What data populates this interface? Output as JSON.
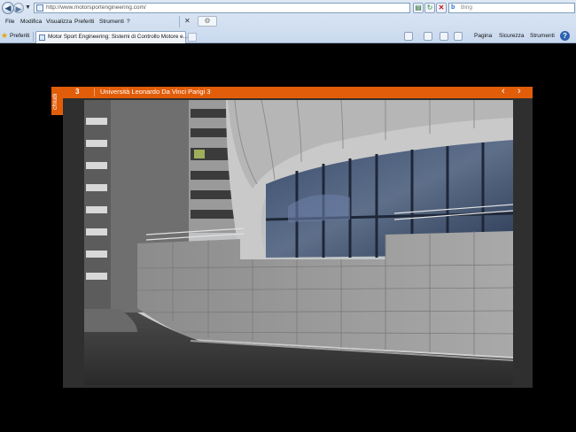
{
  "browser": {
    "address": "http://www.motorsportengineering.com/",
    "search_placeholder": "Bing",
    "bing_logo": "b",
    "menu": [
      "File",
      "Modifica",
      "Visualizza",
      "Preferiti",
      "Strumenti",
      "?"
    ],
    "favorites_label": "Preferiti",
    "tab_title": "Motor Sport Engineering: Sistemi di Controllo Motore e...",
    "commands": [
      "Pagina",
      "Sicurezza",
      "Strumenti"
    ],
    "icons": {
      "back": "back-arrow-icon",
      "forward": "forward-arrow-icon",
      "refresh": "refresh-icon",
      "stop": "stop-icon",
      "favorites": "star-icon",
      "help": "help-icon"
    }
  },
  "gallery": {
    "slide_number": "3",
    "title": "Università Leonardo Da Vinci Parigi 3",
    "close_label": "chiudi",
    "prev_icon": "‹",
    "next_icon": "›",
    "accent_color": "#e25d0a"
  }
}
